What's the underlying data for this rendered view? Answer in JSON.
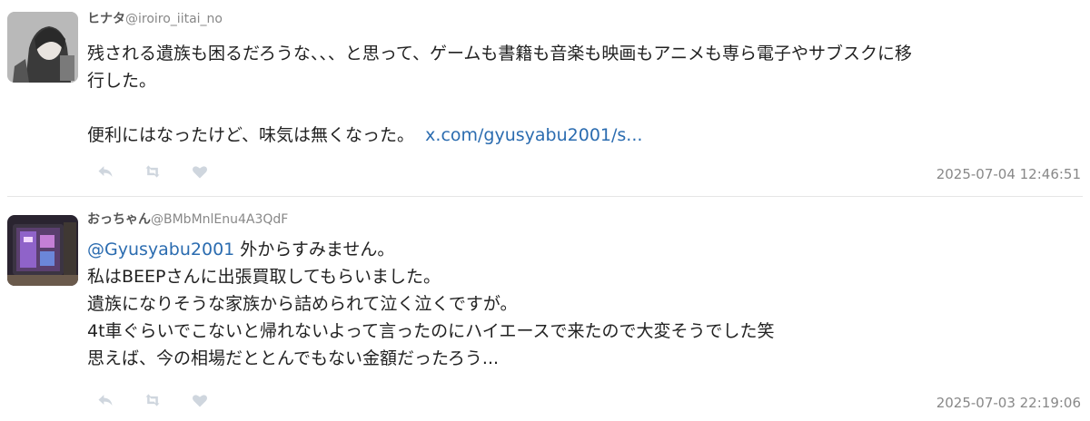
{
  "tweets": [
    {
      "name": "ヒナタ",
      "handle": "@iroiro_iitai_no",
      "lines": [
        "残される遺族も困るだろうな、、、と思って、ゲームも書籍も音楽も映画もアニメも専ら電子やサブスクに移",
        "行した。"
      ],
      "line3_text": "便利にはなったけど、味気は無くなった。",
      "link": "x.com/gyusyabu2001/s...",
      "timestamp": "2025-07-04 12:46:51",
      "actions": [
        "reply-icon",
        "retweet-icon",
        "like-icon"
      ]
    },
    {
      "name": "おっちゃん",
      "handle": "@BMbMnlEnu4A3QdF",
      "mention": "@Gyusyabu2001",
      "first_line_rest": " 外からすみません。",
      "lines": [
        "私はBEEPさんに出張買取してもらいました。",
        "遺族になりそうな家族から詰められて泣く泣くですが。",
        "4t車ぐらいでこないと帰れないよって言ったのにハイエースで来たので大変そうでした笑",
        "思えば、今の相場だととんでもない金額だったろう..."
      ],
      "timestamp": "2025-07-03 22:19:06",
      "actions": [
        "reply-icon",
        "retweet-icon",
        "like-icon"
      ]
    }
  ],
  "colors": {
    "link": "#2b6cb0",
    "icon": "#cfd6de",
    "timestamp": "#888888",
    "divider": "#e6e6e6"
  }
}
